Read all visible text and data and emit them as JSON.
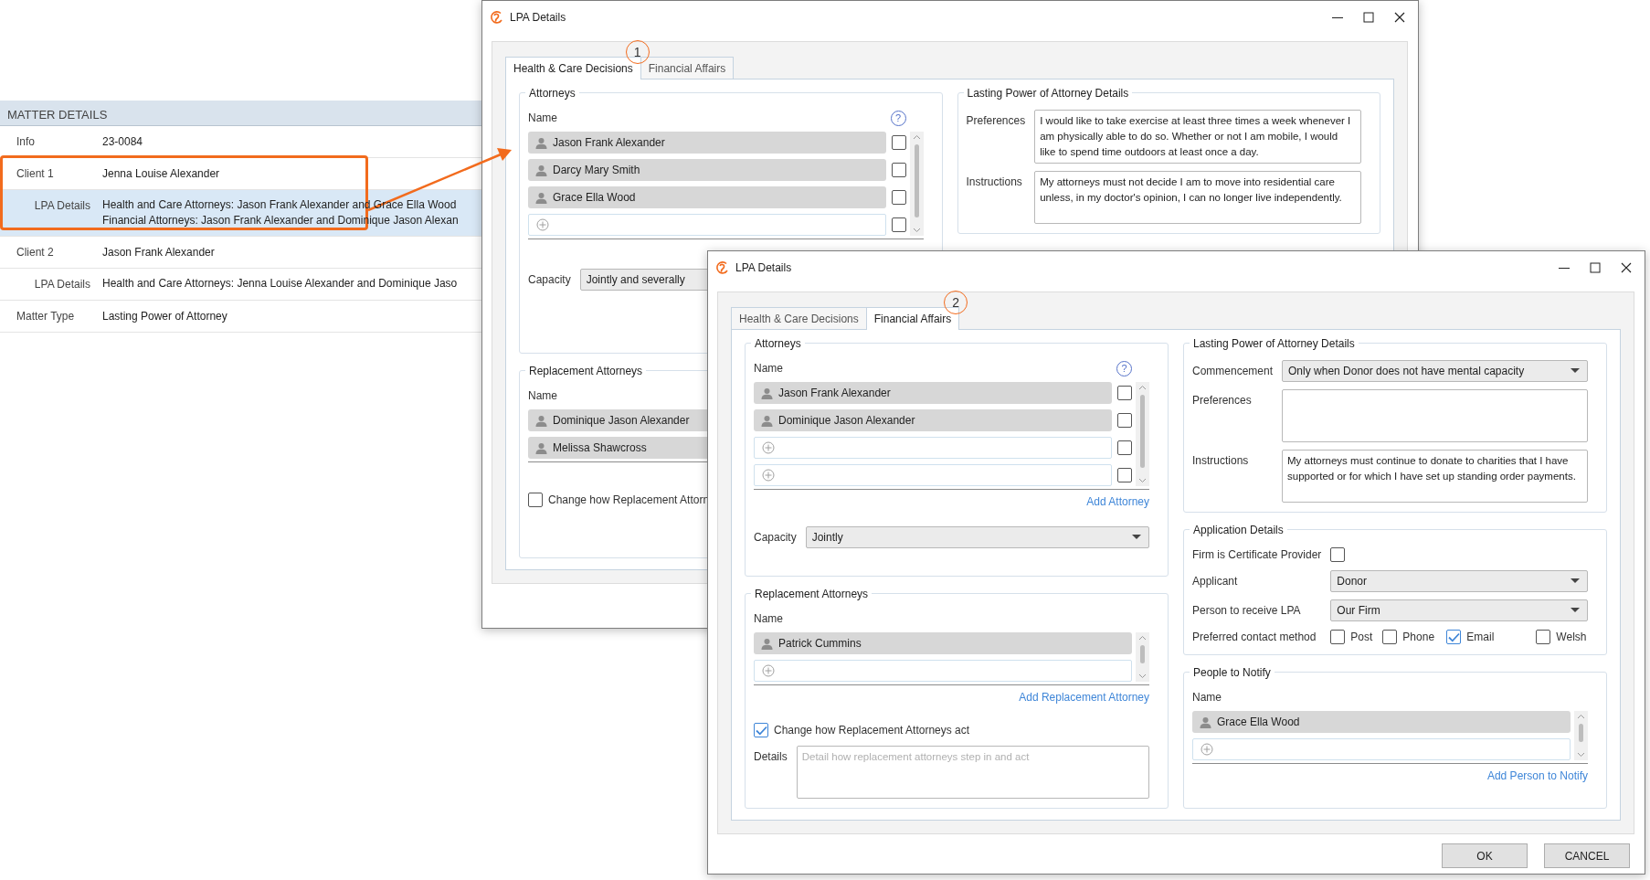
{
  "matter_details": {
    "title": "MATTER DETAILS",
    "rows": [
      {
        "label": "Info",
        "value": "23-0084",
        "selected": false
      },
      {
        "label": "Client 1",
        "value": "Jenna Louise Alexander",
        "selected": false,
        "children": [
          {
            "label": "LPA Details",
            "lines": [
              "Health and Care Attorneys: Jason Frank Alexander and Grace Ella Wood",
              "Financial Attorneys: Jason Frank Alexander and Dominique Jason Alexan"
            ],
            "selected": true
          }
        ]
      },
      {
        "label": "Client 2",
        "value": "Jason Frank Alexander",
        "selected": false,
        "children": [
          {
            "label": "LPA Details",
            "lines": [
              "Health and Care Attorneys: Jenna Louise Alexander and Dominique Jaso"
            ],
            "selected": false
          }
        ]
      },
      {
        "label": "Matter Type",
        "value": "Lasting Power of Attorney",
        "selected": false
      }
    ]
  },
  "windows": [
    {
      "title": "LPA Details",
      "callout": "1",
      "tabs": [
        {
          "label": "Health & Care Decisions",
          "selected": true
        },
        {
          "label": "Financial Affairs",
          "selected": false
        }
      ],
      "columns": [
        [
          {
            "title": "Attorneys",
            "items": [
              {
                "kind": "name_list",
                "label": "Name",
                "help": "?",
                "rows": [
                  {
                    "kind": "person",
                    "name": "Jason Frank Alexander",
                    "checked": false
                  },
                  {
                    "kind": "person",
                    "name": "Darcy Mary Smith",
                    "checked": false
                  },
                  {
                    "kind": "person",
                    "name": "Grace Ella Wood",
                    "checked": false
                  },
                  {
                    "kind": "empty",
                    "checked": false
                  }
                ],
                "scrollbar": true
              },
              {
                "kind": "select",
                "label": "Capacity",
                "value": "Jointly and severally",
                "arrow": false
              }
            ]
          },
          {
            "title": "Replacement Attorneys",
            "items": [
              {
                "kind": "name_list",
                "label": "Name",
                "rows": [
                  {
                    "kind": "person",
                    "name": "Dominique Jason Alexander"
                  },
                  {
                    "kind": "person",
                    "name": "Melissa Shawcross"
                  }
                ]
              },
              {
                "kind": "checkbox",
                "label": "Change how Replacement Attorn",
                "checked": false
              }
            ]
          }
        ],
        [
          {
            "title": "Lasting Power of Attorney Details",
            "items": [
              {
                "kind": "textarea",
                "label": "Preferences",
                "value": "I would like to take exercise at least three times a week whenever I am physically able to do so. Whether or not I am mobile, I would like to spend time outdoors at least once a day."
              },
              {
                "kind": "textarea",
                "label": "Instructions",
                "value": "My attorneys must not decide I am to move into residential care unless, in my doctor's opinion, I can no longer live independently."
              }
            ]
          }
        ]
      ]
    },
    {
      "title": "LPA Details",
      "callout": "2",
      "tabs": [
        {
          "label": "Health & Care Decisions",
          "selected": false
        },
        {
          "label": "Financial Affairs",
          "selected": true
        }
      ],
      "columns": [
        [
          {
            "title": "Attorneys",
            "items": [
              {
                "kind": "name_list",
                "label": "Name",
                "help": "?",
                "rows": [
                  {
                    "kind": "person",
                    "name": "Jason Frank Alexander",
                    "checked": false
                  },
                  {
                    "kind": "person",
                    "name": "Dominique Jason Alexander",
                    "checked": false
                  },
                  {
                    "kind": "empty",
                    "checked": false
                  },
                  {
                    "kind": "empty",
                    "checked": false
                  }
                ],
                "scrollbar": true,
                "link": "Add Attorney"
              },
              {
                "kind": "select",
                "label": "Capacity",
                "value": "Jointly",
                "arrow": true
              }
            ]
          },
          {
            "title": "Replacement Attorneys",
            "items": [
              {
                "kind": "name_list",
                "label": "Name",
                "rows": [
                  {
                    "kind": "person",
                    "name": "Patrick Cummins"
                  },
                  {
                    "kind": "empty"
                  }
                ],
                "scrollbar": true,
                "link": "Add Replacement Attorney"
              },
              {
                "kind": "checkbox",
                "label": "Change how Replacement Attorneys act",
                "checked": true
              },
              {
                "kind": "textarea",
                "label": "Details",
                "placeholder": "Detail how replacement attorneys step in and act"
              }
            ]
          }
        ],
        [
          {
            "title": "Lasting Power of Attorney Details",
            "items": [
              {
                "kind": "select",
                "label": "Commencement",
                "value": "Only when Donor does not have mental capacity",
                "arrow": true
              },
              {
                "kind": "textarea",
                "label": "Preferences"
              },
              {
                "kind": "textarea",
                "label": "Instructions",
                "value": "My attorneys must continue to donate to charities that I have supported or for which I have set up standing order payments."
              }
            ]
          },
          {
            "title": "Application Details",
            "items": [
              {
                "kind": "toggle",
                "label": "Firm is Certificate Provider",
                "checked": false
              },
              {
                "kind": "select",
                "label": "Applicant",
                "value": "Donor",
                "arrow": true
              },
              {
                "kind": "select",
                "label": "Person to receive LPA",
                "value": "Our Firm",
                "arrow": true
              },
              {
                "kind": "options",
                "label": "Preferred contact method",
                "options": [
                  {
                    "label": "Post",
                    "checked": false
                  },
                  {
                    "label": "Phone",
                    "checked": false
                  },
                  {
                    "label": "Email",
                    "checked": true
                  },
                  {
                    "label": "Welsh",
                    "checked": false
                  }
                ]
              }
            ]
          },
          {
            "title": "People to Notify",
            "items": [
              {
                "kind": "name_list",
                "label": "Name",
                "rows": [
                  {
                    "kind": "person",
                    "name": "Grace Ella Wood"
                  },
                  {
                    "kind": "empty"
                  }
                ],
                "scrollbar": true,
                "link": "Add Person to Notify"
              }
            ]
          }
        ]
      ],
      "buttons": [
        "OK",
        "CANCEL"
      ]
    }
  ]
}
